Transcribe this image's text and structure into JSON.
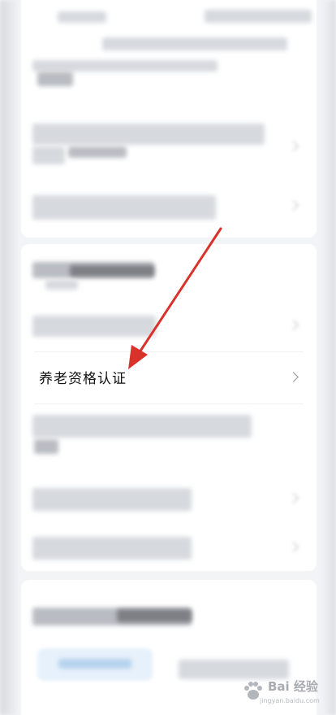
{
  "menu": {
    "highlighted_item": {
      "label": "养老资格认证"
    }
  },
  "watermark": {
    "brand": "Bai 经验",
    "url": "jingyan.baidu.com"
  },
  "colors": {
    "arrow": "#d9322b",
    "background": "#f3f4f6",
    "card": "#ffffff"
  }
}
